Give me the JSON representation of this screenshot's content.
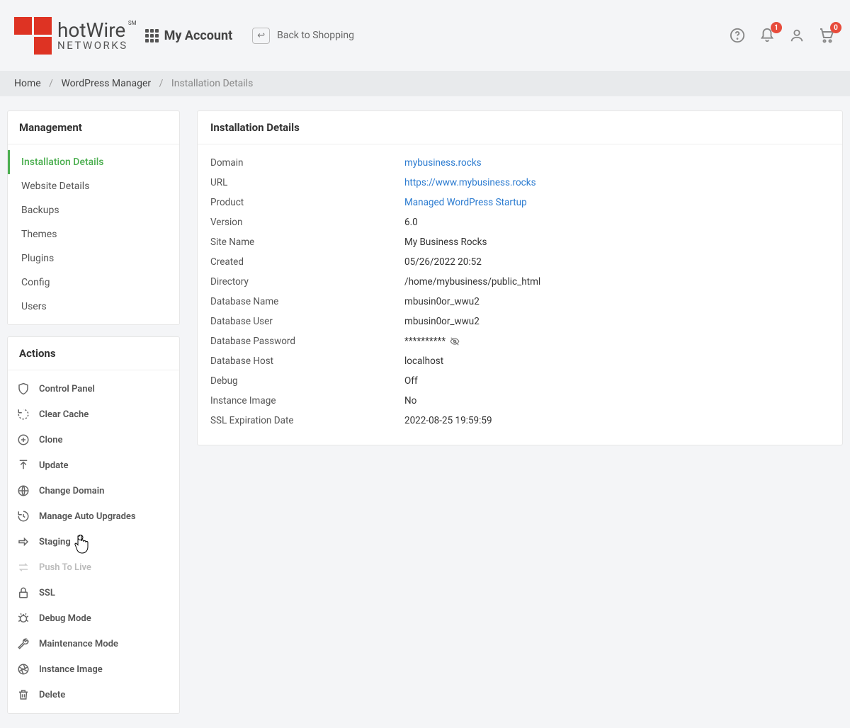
{
  "header": {
    "logo_brand_top": "hotWire",
    "logo_brand_sm": "SM",
    "logo_brand_bot": "NETWORKS",
    "myaccount_label": "My Account",
    "back_label": "Back to Shopping",
    "notifications_badge": "1",
    "cart_badge": "0"
  },
  "breadcrumb": {
    "home": "Home",
    "wp_manager": "WordPress Manager",
    "current": "Installation Details"
  },
  "sidebar": {
    "management_title": "Management",
    "management_items": [
      "Installation Details",
      "Website Details",
      "Backups",
      "Themes",
      "Plugins",
      "Config",
      "Users"
    ],
    "actions_title": "Actions",
    "actions": [
      {
        "label": "Control Panel",
        "icon": "shield",
        "disabled": false
      },
      {
        "label": "Clear Cache",
        "icon": "refresh-dashed",
        "disabled": false
      },
      {
        "label": "Clone",
        "icon": "clone",
        "disabled": false
      },
      {
        "label": "Update",
        "icon": "upload",
        "disabled": false
      },
      {
        "label": "Change Domain",
        "icon": "globe",
        "disabled": false
      },
      {
        "label": "Manage Auto Upgrades",
        "icon": "history",
        "disabled": false
      },
      {
        "label": "Staging",
        "icon": "arrow-right",
        "disabled": false,
        "cursor": true
      },
      {
        "label": "Push To Live",
        "icon": "swap",
        "disabled": true
      },
      {
        "label": "SSL",
        "icon": "lock",
        "disabled": false
      },
      {
        "label": "Debug Mode",
        "icon": "bug",
        "disabled": false
      },
      {
        "label": "Maintenance Mode",
        "icon": "wrench",
        "disabled": false
      },
      {
        "label": "Instance Image",
        "icon": "aperture",
        "disabled": false
      },
      {
        "label": "Delete",
        "icon": "trash",
        "disabled": false
      }
    ]
  },
  "details": {
    "title": "Installation Details",
    "rows": [
      {
        "label": "Domain",
        "value": "mybusiness.rocks",
        "link": true
      },
      {
        "label": "URL",
        "value": "https://www.mybusiness.rocks",
        "link": true
      },
      {
        "label": "Product",
        "value": "Managed WordPress Startup",
        "link": true
      },
      {
        "label": "Version",
        "value": "6.0",
        "link": false
      },
      {
        "label": "Site Name",
        "value": "My Business Rocks",
        "link": false
      },
      {
        "label": "Created",
        "value": "05/26/2022 20:52",
        "link": false
      },
      {
        "label": "Directory",
        "value": "/home/mybusiness/public_html",
        "link": false
      },
      {
        "label": "Database Name",
        "value": "mbusin0or_wwu2",
        "link": false
      },
      {
        "label": "Database User",
        "value": "mbusin0or_wwu2",
        "link": false
      },
      {
        "label": "Database Password",
        "value": "**********",
        "link": false,
        "eye": true
      },
      {
        "label": "Database Host",
        "value": "localhost",
        "link": false
      },
      {
        "label": "Debug",
        "value": "Off",
        "link": false
      },
      {
        "label": "Instance Image",
        "value": "No",
        "link": false
      },
      {
        "label": "SSL Expiration Date",
        "value": "2022-08-25 19:59:59",
        "link": false
      }
    ]
  }
}
